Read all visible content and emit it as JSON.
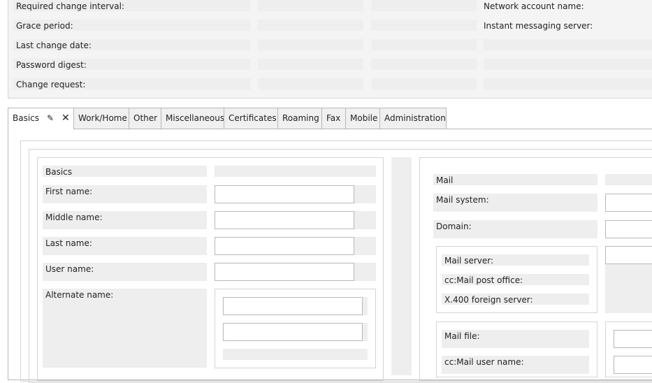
{
  "top_section": {
    "left_labels": [
      "Required change interval:",
      "Grace period:",
      "Last change date:",
      "Password digest:",
      "Change request:"
    ],
    "right_labels": [
      "Network account name:",
      "Instant messaging server:"
    ]
  },
  "tabs": [
    {
      "label": "Basics",
      "active": true
    },
    {
      "label": "Work/Home"
    },
    {
      "label": "Other"
    },
    {
      "label": "Miscellaneous"
    },
    {
      "label": "Certificates"
    },
    {
      "label": "Roaming"
    },
    {
      "label": "Fax"
    },
    {
      "label": "Mobile"
    },
    {
      "label": "Administration"
    }
  ],
  "tab_icons": {
    "edit": "pencil-icon",
    "close": "close-x-icon"
  },
  "basics": {
    "section_title": "Basics",
    "first_name_label": "First name:",
    "middle_name_label": "Middle name:",
    "last_name_label": "Last name:",
    "user_name_label": "User name:",
    "alternate_name_label": "Alternate name:",
    "first_name_value": "",
    "middle_name_value": "",
    "last_name_value": "",
    "user_name_value": "",
    "alternate_name_values": [
      "",
      ""
    ]
  },
  "mail": {
    "section_title": "Mail",
    "mail_system_label": "Mail system:",
    "domain_label": "Domain:",
    "mail_server_label": "Mail server:",
    "ccmail_post_office_label": "cc:Mail post office:",
    "x400_label": "X.400 foreign server:",
    "mail_file_label": "Mail file:",
    "ccmail_user_name_label": "cc:Mail user name:"
  },
  "colors": {
    "cell_bg": "#eeeeee",
    "border": "#b8b8b8",
    "panel_bg": "#f4f4f4"
  }
}
